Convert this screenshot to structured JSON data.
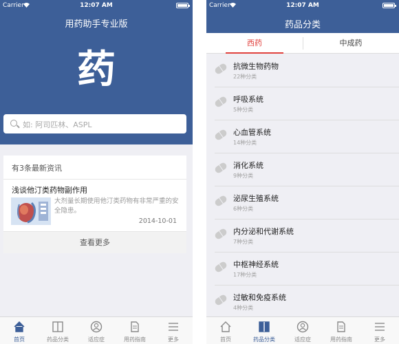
{
  "status": {
    "carrier": "Carrier",
    "time": "12:07 AM"
  },
  "left": {
    "app_title": "用药助手专业版",
    "logo_char": "药",
    "search_placeholder": "如: 阿司匹林、ASPL",
    "news": {
      "count_label": "有3条最新资讯",
      "title": "浅谈他汀类药物副作用",
      "summary": "大剂量长期使用他汀类药物有非常严重的安全隐患。",
      "date": "2014-10-01",
      "more_label": "查看更多"
    }
  },
  "right": {
    "title": "药品分类",
    "segments": [
      {
        "label": "西药",
        "active": true
      },
      {
        "label": "中成药",
        "active": false
      }
    ],
    "categories": [
      {
        "name": "抗微生物药物",
        "count": "22种分类"
      },
      {
        "name": "呼吸系统",
        "count": "5种分类"
      },
      {
        "name": "心血管系统",
        "count": "14种分类"
      },
      {
        "name": "消化系统",
        "count": "9种分类"
      },
      {
        "name": "泌尿生殖系统",
        "count": "6种分类"
      },
      {
        "name": "内分泌和代谢系统",
        "count": "7种分类"
      },
      {
        "name": "中枢神经系统",
        "count": "17种分类"
      },
      {
        "name": "过敏和免疫系统",
        "count": "4种分类"
      }
    ]
  },
  "tabs": [
    {
      "label": "首页",
      "icon": "home-icon"
    },
    {
      "label": "药品分类",
      "icon": "book-icon"
    },
    {
      "label": "适应症",
      "icon": "person-icon"
    },
    {
      "label": "用药指南",
      "icon": "document-icon"
    },
    {
      "label": "更多",
      "icon": "list-icon"
    }
  ],
  "left_active_tab": "首页",
  "right_active_tab": "药品分类",
  "colors": {
    "brand": "#3d5f98",
    "accent": "#e0403c",
    "background": "#efeff4"
  }
}
